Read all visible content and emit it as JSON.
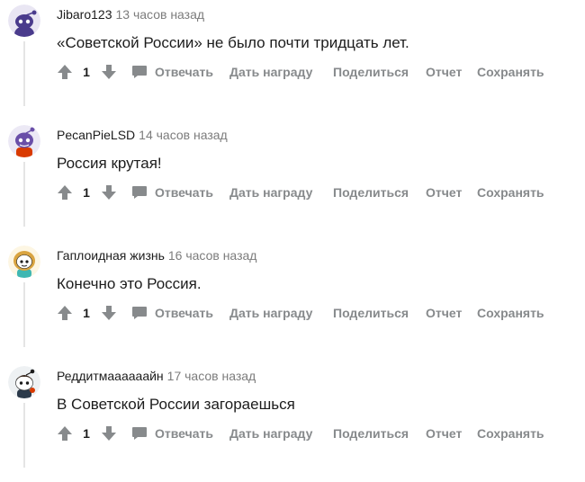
{
  "comments": [
    {
      "author": "Jibaro123",
      "time": "13 часов назад",
      "text": "«Советской России» не было почти тридцать лет.",
      "score": "1",
      "avatar": "snoo-purple-icon"
    },
    {
      "author": "PecanPieLSD",
      "time": "14 часов назад",
      "text": "Россия крутая!",
      "score": "1",
      "avatar": "snoo-purple-red-shirt-icon"
    },
    {
      "author": "Гаплоидная жизнь",
      "time": "16 часов назад",
      "text": "Конечно это Россия.",
      "score": "1",
      "avatar": "snoo-blonde-girl-icon"
    },
    {
      "author": "Реддитмаааааайн",
      "time": "17 часов назад",
      "text": "В Советской России загораешься",
      "score": "1",
      "avatar": "snoo-dark-hair-icon"
    }
  ],
  "actions": {
    "reply": "Отвечать",
    "award": "Дать награду",
    "share": "Поделиться",
    "report": "Отчет",
    "save": "Сохранять"
  },
  "icons": {
    "upvote": "upvote-arrow-icon",
    "downvote": "downvote-arrow-icon",
    "reply": "comment-bubble-icon"
  },
  "colors": {
    "action_text": "#878a8c",
    "time_text": "#7c7c7c",
    "thread_line": "#e5e5e5",
    "body_text": "#1c1c1c"
  }
}
